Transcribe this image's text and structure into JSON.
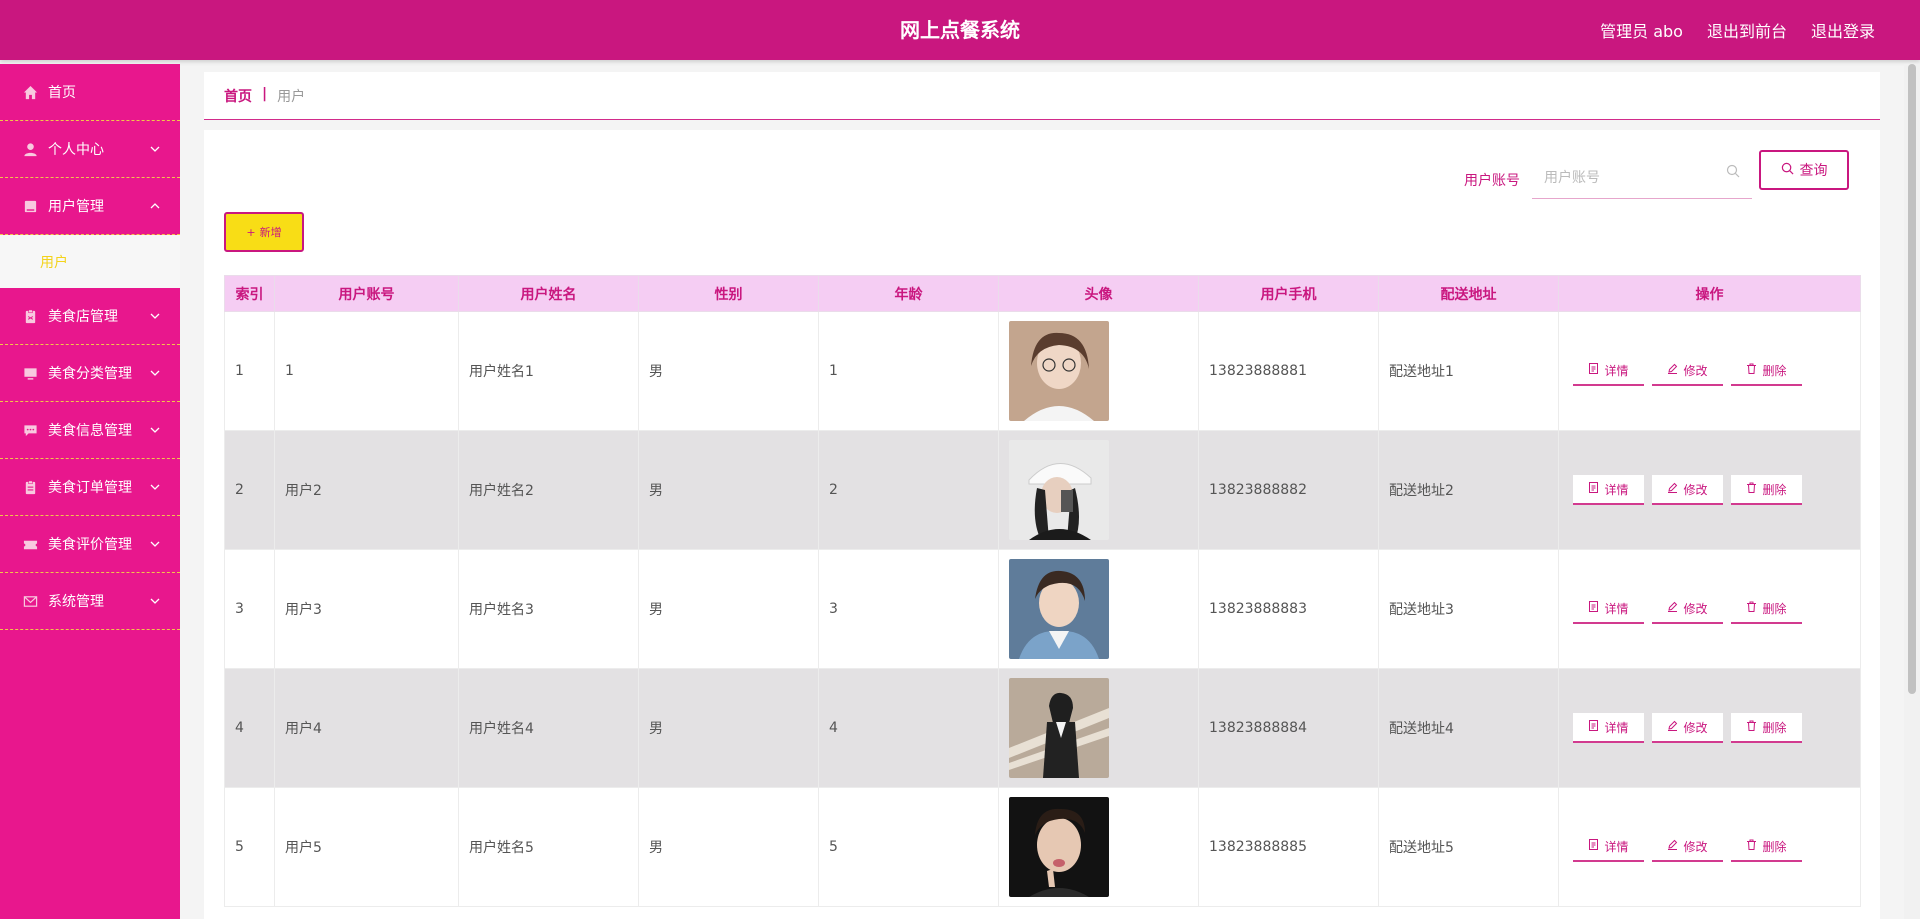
{
  "header": {
    "title": "网上点餐系统",
    "admin": "管理员 abo",
    "to_front": "退出到前台",
    "logout": "退出登录"
  },
  "sidebar": {
    "items": [
      {
        "label": "首页",
        "icon": "home-icon",
        "chevron": "none"
      },
      {
        "label": "个人中心",
        "icon": "user-icon",
        "chevron": "down"
      },
      {
        "label": "用户管理",
        "icon": "book-icon",
        "chevron": "up"
      },
      {
        "label": "美食店管理",
        "icon": "clipboard-icon",
        "chevron": "down"
      },
      {
        "label": "美食分类管理",
        "icon": "monitor-icon",
        "chevron": "down"
      },
      {
        "label": "美食信息管理",
        "icon": "message-icon",
        "chevron": "down"
      },
      {
        "label": "美食订单管理",
        "icon": "clipboard-icon",
        "chevron": "down"
      },
      {
        "label": "美食评价管理",
        "icon": "ticket-icon",
        "chevron": "down"
      },
      {
        "label": "系统管理",
        "icon": "mail-icon",
        "chevron": "down"
      }
    ],
    "submenu_active": "用户"
  },
  "breadcrumb": {
    "home": "首页",
    "separator": "|",
    "current": "用户"
  },
  "search": {
    "label": "用户账号",
    "placeholder": "用户账号",
    "button": "查询"
  },
  "add_button": "新增",
  "table": {
    "headers": [
      "索引",
      "用户账号",
      "用户姓名",
      "性别",
      "年龄",
      "头像",
      "用户手机",
      "配送地址",
      "操作"
    ],
    "rows": [
      {
        "index": "1",
        "account": "1",
        "name": "用户姓名1",
        "gender": "男",
        "age": "1",
        "phone": "13823888881",
        "address": "配送地址1"
      },
      {
        "index": "2",
        "account": "用户2",
        "name": "用户姓名2",
        "gender": "男",
        "age": "2",
        "phone": "13823888882",
        "address": "配送地址2"
      },
      {
        "index": "3",
        "account": "用户3",
        "name": "用户姓名3",
        "gender": "男",
        "age": "3",
        "phone": "13823888883",
        "address": "配送地址3"
      },
      {
        "index": "4",
        "account": "用户4",
        "name": "用户姓名4",
        "gender": "男",
        "age": "4",
        "phone": "13823888884",
        "address": "配送地址4"
      },
      {
        "index": "5",
        "account": "用户5",
        "name": "用户姓名5",
        "gender": "男",
        "age": "5",
        "phone": "13823888885",
        "address": "配送地址5"
      }
    ],
    "ops": {
      "detail": "详情",
      "edit": "修改",
      "delete": "删除"
    }
  },
  "colors": {
    "header": "#c9177f",
    "sidebar": "#e8178d",
    "accent_yellow": "#f8dd16",
    "table_header": "#f5cdf3"
  }
}
